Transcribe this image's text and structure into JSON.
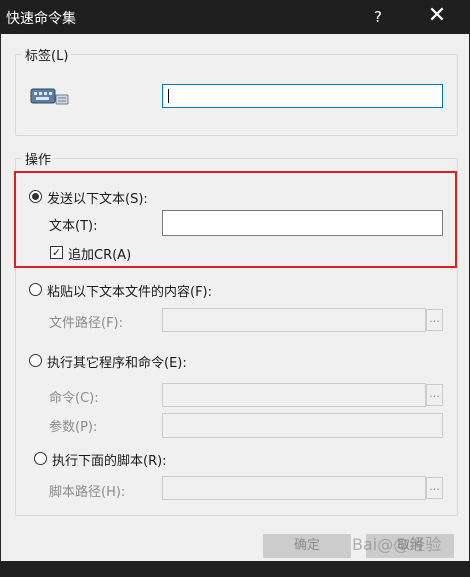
{
  "window": {
    "title": "快速命令集",
    "help_glyph": "?",
    "close_glyph": "✕"
  },
  "label_group": {
    "legend": "标签(L)",
    "icon": "keyboard-icon",
    "value": ""
  },
  "operation_group": {
    "legend": "操作",
    "send_text": {
      "label": "发送以下文本(S):",
      "selected": true,
      "text_label": "文本(T):",
      "text_value": "",
      "append_cr_label": "追加CR(A)",
      "append_cr_checked": true,
      "check_glyph": "✓"
    },
    "paste_file": {
      "label": "粘贴以下文本文件的内容(F):",
      "selected": false,
      "path_label": "文件路径(F):",
      "path_value": "",
      "browse_label": "..."
    },
    "run_program": {
      "label": "执行其它程序和命令(E):",
      "selected": false,
      "command_label": "命令(C):",
      "command_value": "",
      "browse_label": "...",
      "params_label": "参数(P):",
      "params_value": ""
    },
    "run_script": {
      "label": "执行下面的脚本(R):",
      "selected": false,
      "path_label": "脚本路径(H):",
      "path_value": "",
      "browse_label": "..."
    }
  },
  "buttons": {
    "ok_label": "确定",
    "cancel_label": "取消"
  },
  "watermark": "Bai@@经验",
  "colors": {
    "title_bar": "#1f1f1f",
    "dialog_bg": "#f0f0f0",
    "focus_border": "#0078d7",
    "highlight_border": "#e02020"
  }
}
